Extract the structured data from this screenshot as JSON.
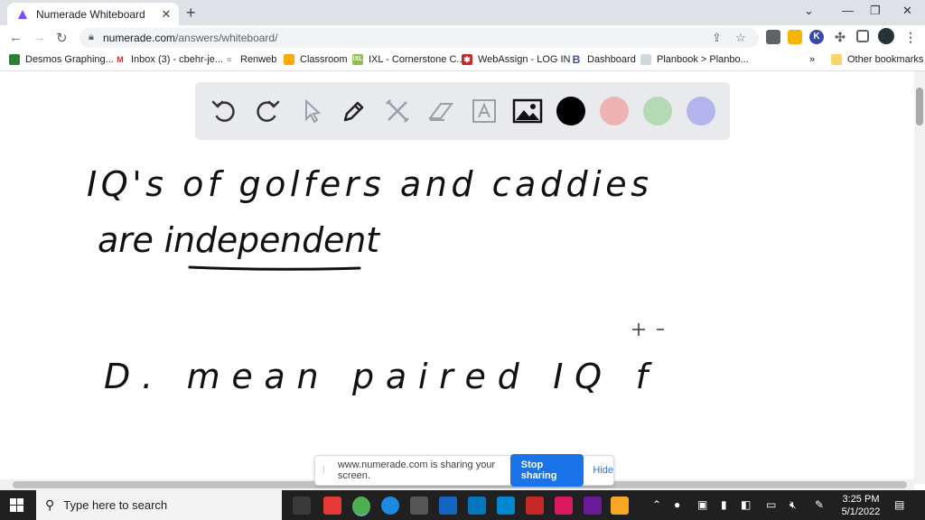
{
  "browser": {
    "tab_title": "Numerade Whiteboard",
    "url_host": "numerade.com",
    "url_path": "/answers/whiteboard/",
    "new_tab_symbol": "+",
    "close_symbol": "✕"
  },
  "bookmarks": {
    "items": [
      {
        "label": "Desmos Graphing...",
        "icon": "desmos-icon",
        "color": "#2e7d32"
      },
      {
        "label": "Inbox (3) - cbehr-je...",
        "icon": "gmail-icon",
        "color": "#d93025"
      },
      {
        "label": "Renweb",
        "icon": "renweb-icon",
        "color": "#888888"
      },
      {
        "label": "Classroom",
        "icon": "classroom-icon",
        "color": "#f9ab00"
      },
      {
        "label": "IXL - Cornerstone C...",
        "icon": "ixl-icon",
        "color": "#8bc34a"
      },
      {
        "label": "WebAssign - LOG IN",
        "icon": "webassign-icon",
        "color": "#c62828"
      },
      {
        "label": "Dashboard",
        "icon": "dashboard-icon",
        "color": "#3949ab"
      },
      {
        "label": "Planbook > Planbo...",
        "icon": "planbook-icon",
        "color": "#90a4ae"
      }
    ],
    "overflow": "»",
    "other_label": "Other bookmarks"
  },
  "toolbar": {
    "tools": [
      "undo-icon",
      "redo-icon",
      "pointer-icon",
      "pen-icon",
      "tools-icon",
      "eraser-icon",
      "text-icon",
      "image-icon"
    ],
    "colors": [
      "#000000",
      "#f0b3b3",
      "#b3dab3",
      "#b3b3ee"
    ]
  },
  "whiteboard": {
    "line1": "IQ's of golfers and caddies",
    "line2": "are independent",
    "line3": "D. mean paired IQ f"
  },
  "share": {
    "message": "www.numerade.com is sharing your screen.",
    "stop_label": "Stop sharing",
    "hide_label": "Hide"
  },
  "taskbar": {
    "search_placeholder": "Type here to search",
    "time": "3:25 PM",
    "date": "5/1/2022"
  }
}
